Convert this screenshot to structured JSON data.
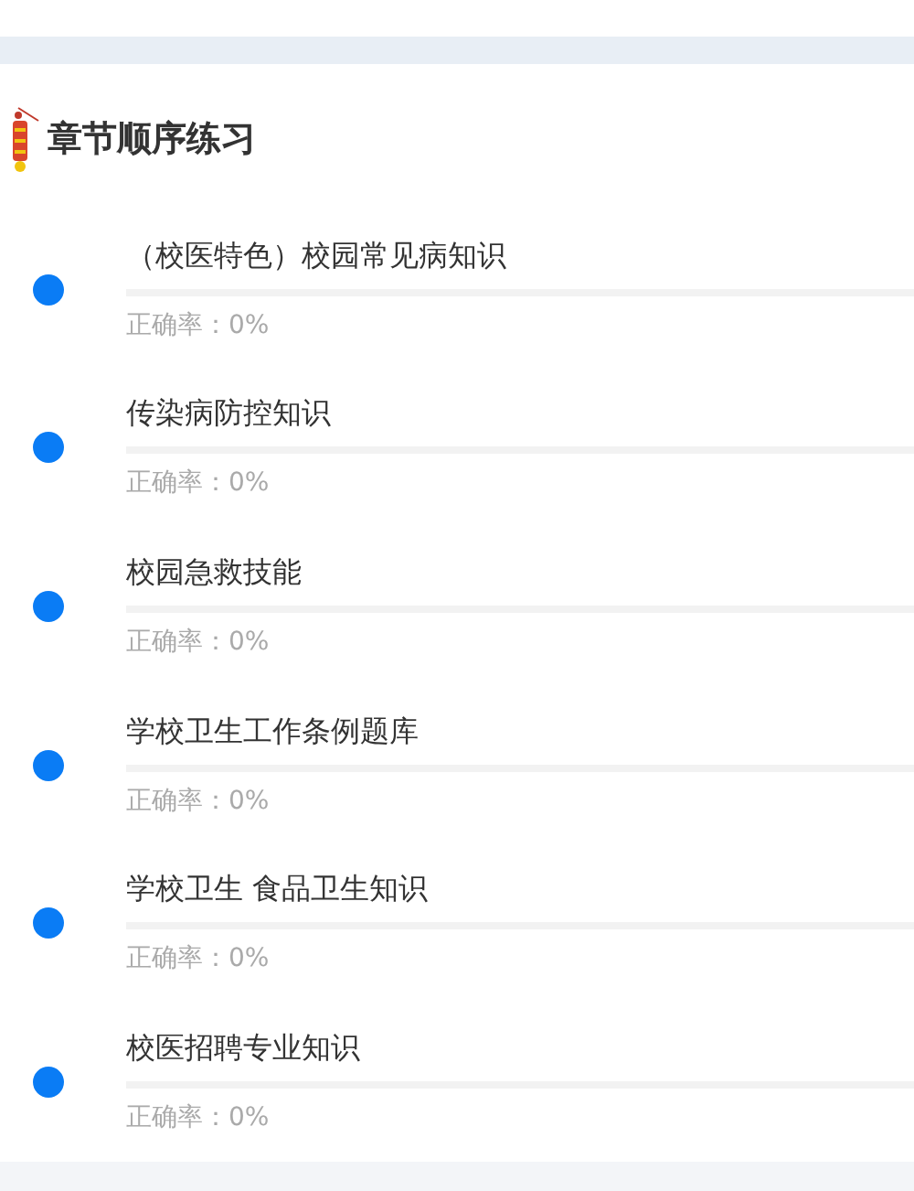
{
  "section": {
    "title": "章节顺序练习"
  },
  "chapters": [
    {
      "name": "（校医特色）校园常见病知识",
      "level": 0,
      "accuracy": "正确率：0%"
    },
    {
      "name": "传染病防控知识",
      "level": 0,
      "accuracy": "正确率：0%"
    },
    {
      "name": "校园急救技能",
      "level": 0,
      "accuracy": "正确率：0%"
    },
    {
      "name": "学校卫生工作条例题库",
      "level": 0,
      "accuracy": "正确率：0%"
    },
    {
      "name": "学校卫生 食品卫生知识",
      "level": 0,
      "accuracy": "正确率：0%"
    },
    {
      "name": "校医招聘专业知识",
      "level": 0,
      "accuracy": "正确率：0%"
    }
  ]
}
